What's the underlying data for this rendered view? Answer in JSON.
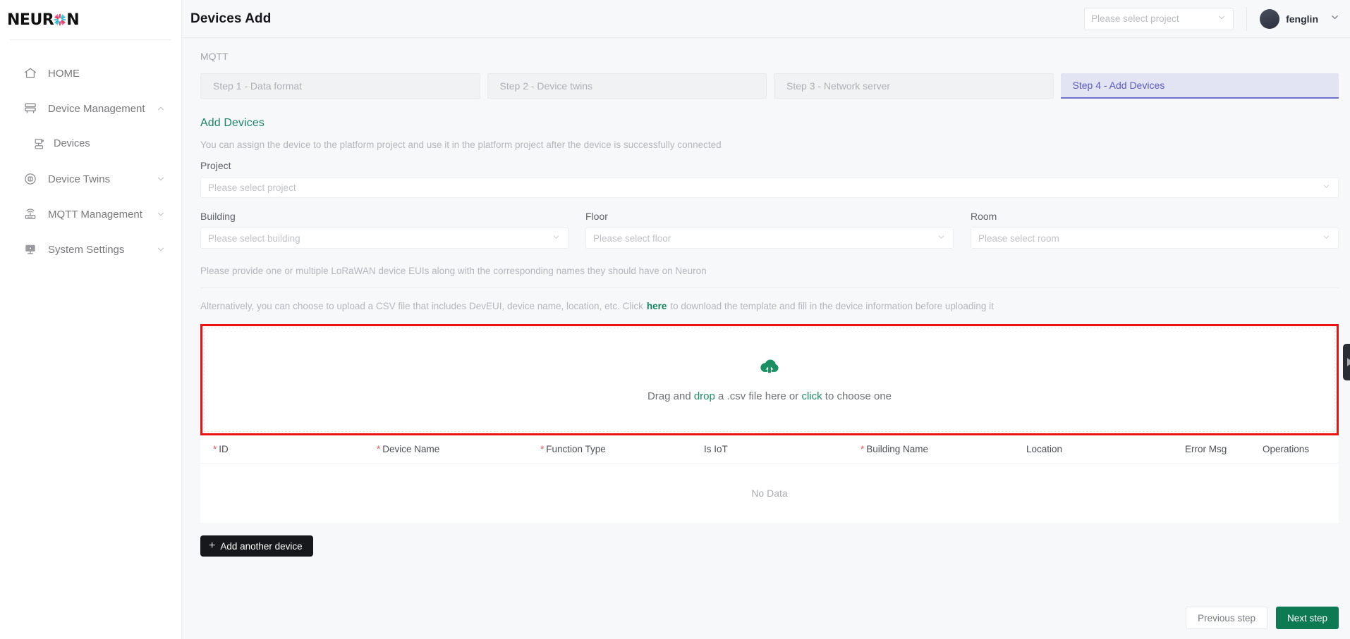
{
  "brand": {
    "name": "NEURON"
  },
  "sidebar": {
    "items": [
      {
        "label": "HOME",
        "icon": "home-icon",
        "expandable": false,
        "sub": false
      },
      {
        "label": "Device Management",
        "icon": "server-icon",
        "expandable": true,
        "arrow": "chevron-up",
        "sub": false
      },
      {
        "label": "Devices",
        "icon": "device-icon",
        "expandable": false,
        "sub": true,
        "active": true
      },
      {
        "label": "Device Twins",
        "icon": "twins-icon",
        "expandable": true,
        "arrow": "chevron-down",
        "sub": false
      },
      {
        "label": "MQTT Management",
        "icon": "router-icon",
        "expandable": true,
        "arrow": "chevron-down",
        "sub": false
      },
      {
        "label": "System Settings",
        "icon": "monitor-icon",
        "expandable": true,
        "arrow": "chevron-down",
        "sub": false
      }
    ]
  },
  "topbar": {
    "title": "Devices Add",
    "project_placeholder": "Please select project",
    "user_name": "fenglin"
  },
  "breadcrumb": "MQTT",
  "steps": [
    {
      "label": "Step 1 - Data format",
      "active": false
    },
    {
      "label": "Step 2 - Device twins",
      "active": false
    },
    {
      "label": "Step 3 - Network server",
      "active": false
    },
    {
      "label": "Step 4 - Add Devices",
      "active": true
    }
  ],
  "section": {
    "title": "Add Devices",
    "description": "You can assign the device to the platform project and use it in the platform project after the device is successfully connected"
  },
  "form": {
    "project": {
      "label": "Project",
      "placeholder": "Please select project"
    },
    "building": {
      "label": "Building",
      "placeholder": "Please select building"
    },
    "floor": {
      "label": "Floor",
      "placeholder": "Please select floor"
    },
    "room": {
      "label": "Room",
      "placeholder": "Please select room"
    }
  },
  "hints": {
    "line1": "Please provide one or multiple LoRaWAN device EUIs along with the corresponding names they should have on Neuron",
    "line2_before": "Alternatively, you can choose to upload a CSV file that includes DevEUI, device name, location, etc. Click",
    "line2_link": "here",
    "line2_after": "to download the template and fill in the device information before uploading it"
  },
  "dropzone": {
    "icon": "cloud-upload-icon",
    "text_1": "Drag and ",
    "text_drop": "drop",
    "text_2": " a .csv file here or ",
    "text_click": "click",
    "text_3": " to choose one"
  },
  "table": {
    "columns": [
      {
        "label": "ID",
        "required": true
      },
      {
        "label": "Device Name",
        "required": true
      },
      {
        "label": "Function Type",
        "required": true
      },
      {
        "label": "Is IoT",
        "required": false
      },
      {
        "label": "Building Name",
        "required": true
      },
      {
        "label": "Location",
        "required": false
      },
      {
        "label": "Error Msg",
        "required": false
      },
      {
        "label": "Operations",
        "required": false
      }
    ],
    "rows": [],
    "empty_text": "No Data"
  },
  "actions": {
    "add_another": "Add another device",
    "previous_step": "Previous step",
    "next_step": "Next step"
  },
  "colors": {
    "accent_green": "#0d7a54",
    "step_active_text": "#5a5bbd",
    "step_active_bg": "#e2e3f3",
    "required_red": "#f15a5a",
    "annotation_red": "#ee1111",
    "dark_button": "#17181c"
  }
}
